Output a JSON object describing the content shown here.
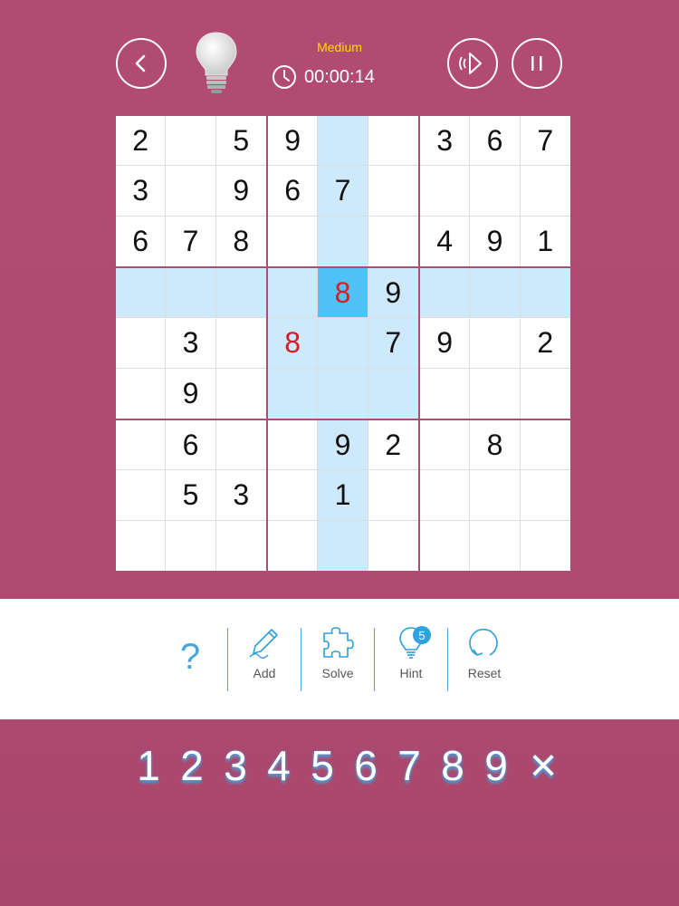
{
  "header": {
    "difficulty": "Medium",
    "timer": "00:00:14"
  },
  "board": {
    "cells": [
      [
        "2",
        "",
        "5",
        "9",
        "",
        "",
        "3",
        "6",
        "7"
      ],
      [
        "3",
        "",
        "9",
        "6",
        "7",
        "",
        "",
        "",
        ""
      ],
      [
        "6",
        "7",
        "8",
        "",
        "",
        "",
        "4",
        "9",
        "1"
      ],
      [
        "",
        "",
        "",
        "",
        "8",
        "9",
        "",
        "",
        ""
      ],
      [
        "",
        "3",
        "",
        "8",
        "",
        "7",
        "9",
        "",
        "2"
      ],
      [
        "",
        "9",
        "",
        "",
        "",
        "",
        "",
        "",
        ""
      ],
      [
        "",
        "6",
        "",
        "",
        "9",
        "2",
        "",
        "8",
        ""
      ],
      [
        "",
        "5",
        "3",
        "",
        "1",
        "",
        "",
        "",
        ""
      ],
      [
        "",
        "",
        "",
        "",
        "",
        "",
        "",
        "",
        ""
      ]
    ],
    "selected": [
      3,
      4
    ],
    "errors": [
      [
        3,
        4
      ],
      [
        4,
        3
      ]
    ],
    "colors": {
      "highlight": "#cde9fb",
      "selected": "#4fc3f7",
      "error": "#d81b24",
      "background": "#b24b72"
    }
  },
  "toolbar": {
    "help_label": "?",
    "add_label": "Add",
    "solve_label": "Solve",
    "hint_label": "Hint",
    "hint_count": "5",
    "reset_label": "Reset"
  },
  "numpad": {
    "keys": [
      "1",
      "2",
      "3",
      "4",
      "5",
      "6",
      "7",
      "8",
      "9"
    ],
    "clear": "×"
  }
}
